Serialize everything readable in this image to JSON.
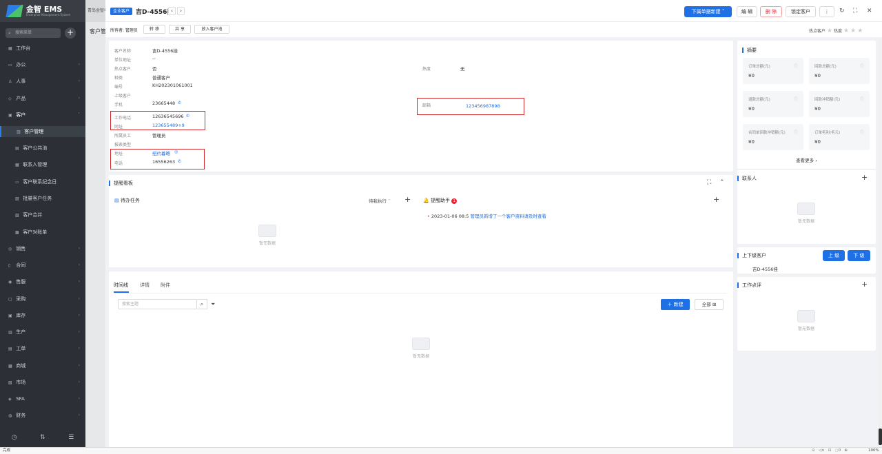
{
  "app": {
    "brand": "金智 EMS",
    "brand_sub": "Enterprise Management System",
    "company": "青岛金智电子"
  },
  "sidebar": {
    "search_placeholder": "搜索菜单",
    "items": [
      {
        "label": "工作台",
        "icon": "dashboard-icon"
      },
      {
        "label": "办公",
        "icon": "office-icon"
      },
      {
        "label": "人事",
        "icon": "person-icon"
      },
      {
        "label": "产品",
        "icon": "product-icon"
      },
      {
        "label": "客户",
        "icon": "customer-icon"
      },
      {
        "label": "客户管理",
        "icon": "customer-manage-icon"
      },
      {
        "label": "客户公共池",
        "icon": "pool-icon"
      },
      {
        "label": "联系人管理",
        "icon": "contact-icon"
      },
      {
        "label": "客户联系纪念日",
        "icon": "calendar-icon"
      },
      {
        "label": "批量客户任务",
        "icon": "task-icon"
      },
      {
        "label": "客户合并",
        "icon": "merge-icon"
      },
      {
        "label": "客户对账单",
        "icon": "statement-icon"
      },
      {
        "label": "销售",
        "icon": "sales-icon"
      },
      {
        "label": "合同",
        "icon": "contract-icon"
      },
      {
        "label": "售服",
        "icon": "service-icon"
      },
      {
        "label": "采购",
        "icon": "purchase-icon"
      },
      {
        "label": "库存",
        "icon": "stock-icon"
      },
      {
        "label": "生产",
        "icon": "production-icon"
      },
      {
        "label": "工单",
        "icon": "workorder-icon"
      },
      {
        "label": "商城",
        "icon": "mall-icon"
      },
      {
        "label": "市场",
        "icon": "market-icon"
      },
      {
        "label": "SFA",
        "icon": "sfa-icon"
      },
      {
        "label": "财务",
        "icon": "finance-icon"
      }
    ]
  },
  "background": {
    "title": "客户管"
  },
  "drawer": {
    "tag": "企业客户",
    "title": "吉D-4556挂",
    "buttons": {
      "new": "下属单据新建",
      "edit": "编 辑",
      "delete": "删 除",
      "lock": "锁定客户"
    },
    "owner": "所有者: 管理员",
    "toolbar": {
      "transfer": "转 移",
      "share": "共 享",
      "to_pool": "放入客户池"
    },
    "hot_label": "热点客户",
    "heat_label": "热度"
  },
  "info": {
    "rows": [
      {
        "label": "客户名称",
        "value": "吉D-4556挂"
      },
      {
        "label": "单位地址",
        "value": "--"
      },
      {
        "label": "热点客户",
        "value": "否"
      },
      {
        "label": "种类",
        "value": "普通客户"
      },
      {
        "label": "编号",
        "value": "KH202301061001"
      },
      {
        "label": "上级客户",
        "value": ""
      },
      {
        "label": "手机",
        "value": "23665448"
      },
      {
        "label": "工作电话",
        "value": "12636545696"
      },
      {
        "label": "网址",
        "value": "123655489+9"
      },
      {
        "label": "所属员工",
        "value": "管理员"
      },
      {
        "label": "报表类型",
        "value": ""
      },
      {
        "label": "地址",
        "value": "纽约暮略"
      },
      {
        "label": "电话",
        "value": "16556263"
      }
    ],
    "heat": {
      "label": "热度",
      "value": "无"
    },
    "email": {
      "label": "邮箱",
      "value": "123456987898"
    }
  },
  "summary": {
    "title": "摘要",
    "cards": [
      {
        "label": "订单总额(元)",
        "value": "¥0"
      },
      {
        "label": "回款总额(元)",
        "value": "¥0"
      },
      {
        "label": "退款总额(元)",
        "value": "¥0"
      },
      {
        "label": "回款冲销额(元)",
        "value": "¥0"
      },
      {
        "label": "合同单回款冲销额(元)",
        "value": "¥0"
      },
      {
        "label": "订单毛利(毛元)",
        "value": "¥0"
      }
    ],
    "more": "查看更多 ›"
  },
  "contacts": {
    "title": "联系人",
    "empty": "暂无数据"
  },
  "hierarchy": {
    "title": "上下级客户",
    "up": "上 级",
    "down": "下 级",
    "item": "吉D-4556挂"
  },
  "review": {
    "title": "工作点评",
    "empty": "暂无数据"
  },
  "remind": {
    "title": "提醒看板",
    "todo_title": "待办任务",
    "todo_filter": "待我执行",
    "todo_empty": "暂无数据",
    "assistant_title": "提醒助手",
    "assistant_badge": "1",
    "entry_time": "2023-01-06 08:5",
    "entry_text": "管理员新增了一个客户资料请及时查看"
  },
  "timeline": {
    "tabs": [
      "时间线",
      "详情",
      "附件"
    ],
    "search_placeholder": "搜索主题",
    "create": "新建",
    "all": "全部",
    "empty": "暂无数据"
  },
  "statusbar": {
    "left": "完成",
    "zoom": "100%"
  }
}
